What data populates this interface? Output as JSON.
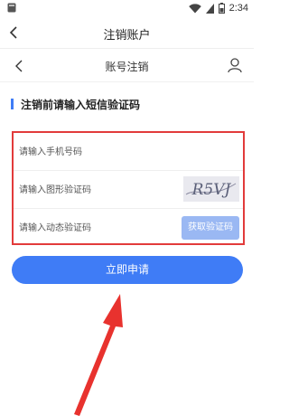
{
  "status_bar": {
    "time": "2:34"
  },
  "outer_nav": {
    "title": "注销账户"
  },
  "inner_nav": {
    "title": "账号注销"
  },
  "section": {
    "title": "注销前请输入短信验证码"
  },
  "form": {
    "phone_placeholder": "请输入手机号码",
    "image_code_placeholder": "请输入图形验证码",
    "captcha_text": "R5VJ",
    "sms_code_placeholder": "请输入动态验证码",
    "get_code_label": "获取验证码"
  },
  "submit_label": "立即申请",
  "colors": {
    "accent": "#3f7cf6",
    "highlight": "#e23b3b",
    "annotation_arrow": "#e8322e"
  }
}
